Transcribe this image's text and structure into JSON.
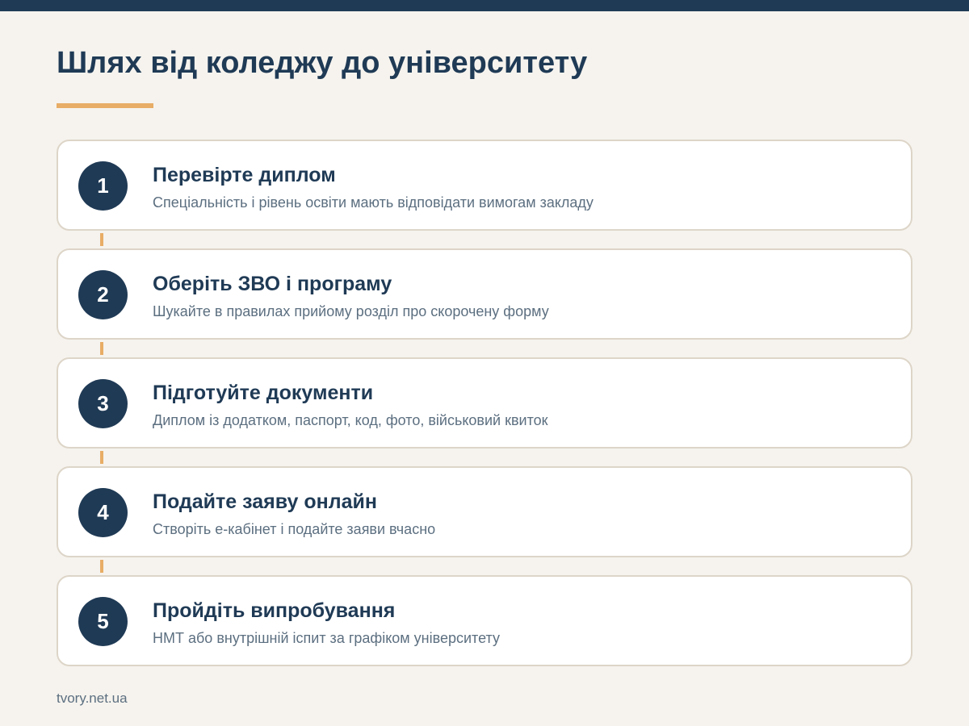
{
  "title": "Шлях від коледжу до університету",
  "colors": {
    "primary": "#1f3a55",
    "accent": "#e8ad66",
    "background": "#f6f3ee",
    "card_border": "#ddd5c8",
    "muted_text": "#5c6f80"
  },
  "steps": [
    {
      "number": "1",
      "title": "Перевірте диплом",
      "description": "Спеціальність і рівень освіти мають відповідати вимогам закладу"
    },
    {
      "number": "2",
      "title": "Оберіть ЗВО і програму",
      "description": "Шукайте в правилах прийому розділ про скорочену форму"
    },
    {
      "number": "3",
      "title": "Підготуйте документи",
      "description": "Диплом із додатком, паспорт, код, фото, військовий квиток"
    },
    {
      "number": "4",
      "title": "Подайте заяву онлайн",
      "description": "Створіть е-кабінет і подайте заяви вчасно"
    },
    {
      "number": "5",
      "title": "Пройдіть випробування",
      "description": "НМТ або внутрішній іспит за графіком університету"
    }
  ],
  "footer": {
    "source": "tvory.net.ua"
  }
}
